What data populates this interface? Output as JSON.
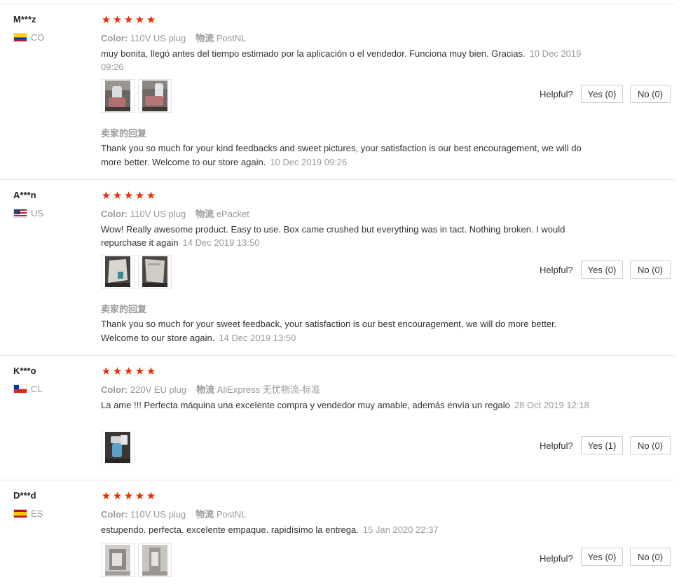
{
  "labels": {
    "color": "Color:",
    "shipping": "物流",
    "helpful": "Helpful?",
    "seller_reply": "卖家的回复"
  },
  "colors": {
    "star": "#e62e04",
    "muted": "#999999",
    "border": "#cccccc"
  },
  "reviews": [
    {
      "user": "M***z",
      "country": "CO",
      "flag": "colombia-flag",
      "stars": 5,
      "color": "110V US plug",
      "shipping": "PostNL",
      "text": "muy bonita, llegó antes del tiempo estimado por la aplicación o el vendedor. Funciona muy bien. Gracias.",
      "date": "10 Dec 2019 09:26",
      "photos": 2,
      "yes": "Yes (0)",
      "no": "No (0)",
      "reply": "Thank you so much for your kind feedbacks and sweet pictures, your satisfaction is our best encouragement, we will do more better. Welcome to our store again.",
      "reply_date": "10 Dec 2019 09:26"
    },
    {
      "user": "A***n",
      "country": "US",
      "flag": "usa-flag",
      "stars": 5,
      "color": "110V US plug",
      "shipping": "ePacket",
      "text": "Wow! Really awesome product. Easy to use. Box came crushed but everything was in tact. Nothing broken. I would repurchase it again",
      "date": "14 Dec 2019 13:50",
      "photos": 2,
      "yes": "Yes (0)",
      "no": "No (0)",
      "reply": "Thank you so much for your sweet feedback, your satisfaction is our best encouragement, we will do more better. Welcome to our store again.",
      "reply_date": "14 Dec 2019 13:50"
    },
    {
      "user": "K***o",
      "country": "CL",
      "flag": "chile-flag",
      "stars": 5,
      "color": "220V EU plug",
      "shipping": "AliExpress 无忧物流-标准",
      "text": "La ame !!! Perfecta máquina una excelente compra y vendedor muy amable, además envía un regalo",
      "date": "28 Oct 2019 12:18",
      "photos": 1,
      "yes": "Yes (1)",
      "no": "No (0)"
    },
    {
      "user": "D***d",
      "country": "ES",
      "flag": "spain-flag",
      "stars": 5,
      "color": "110V US plug",
      "shipping": "PostNL",
      "text": "estupendo. perfecta. excelente empaque. rapidísimo la entrega.",
      "date": "15 Jan 2020 22:37",
      "photos": 2,
      "yes": "Yes (0)",
      "no": "No (0)"
    }
  ]
}
